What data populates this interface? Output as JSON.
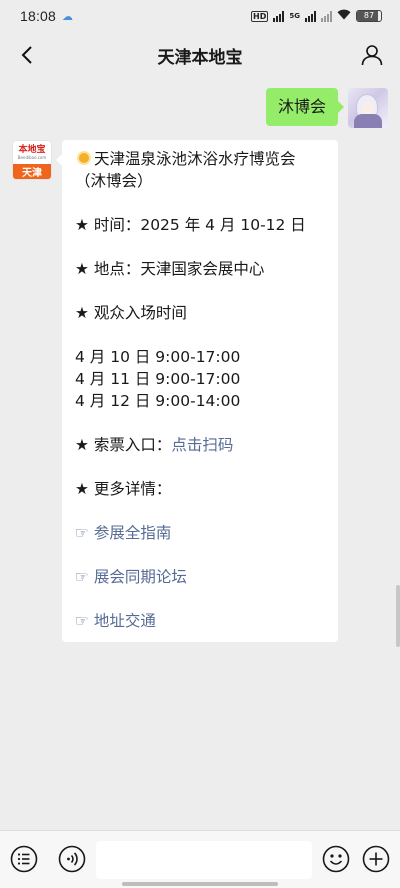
{
  "status_bar": {
    "time": "18:08",
    "network_label": "5G",
    "battery_level": "87"
  },
  "header": {
    "title": "天津本地宝"
  },
  "outgoing_message": {
    "text": "沐博会"
  },
  "incoming_avatar": {
    "logo_text": "本地宝",
    "logo_url": "Bendibao.com",
    "city": "天津"
  },
  "incoming_message": {
    "title_line1": "天津温泉泳池沐浴水疗博览会",
    "title_line2": "（沐博会）",
    "time_label": "★ 时间：",
    "time_value": "2025 年 4 月 10-12 日",
    "place_label": "★ 地点：",
    "place_value": "天津国家会展中心",
    "entry_heading": "★ 观众入场时间",
    "schedule": [
      "4 月 10 日 9:00-17:00",
      "4 月 11 日 9:00-17:00",
      "4 月 12 日 9:00-14:00"
    ],
    "ticket_label": "★ 索票入口：",
    "ticket_link": "点击扫码",
    "details_heading": "★ 更多详情：",
    "links": [
      {
        "prefix": "☞ ",
        "label": "参展全指南"
      },
      {
        "prefix": "☞ ",
        "label": "展会同期论坛"
      },
      {
        "prefix": "☞ ",
        "label": "地址交通"
      }
    ]
  },
  "input_bar": {
    "value": ""
  },
  "colors": {
    "background": "#ededed",
    "outgoing_bubble": "#95ec69",
    "link": "#576b95",
    "brand_orange": "#f0651e"
  },
  "icons": [
    "back-icon",
    "person-icon",
    "menu-icon",
    "voice-icon",
    "emoji-icon",
    "plus-icon",
    "sun-icon"
  ]
}
